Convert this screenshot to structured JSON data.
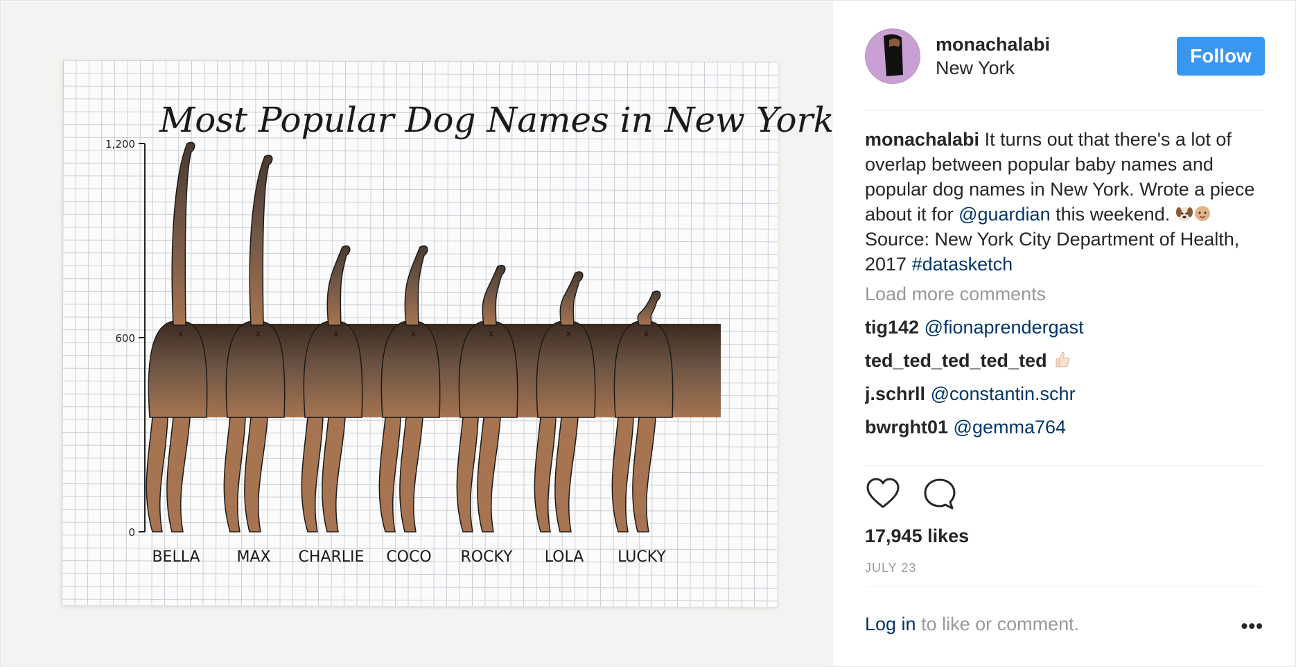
{
  "post": {
    "chart_image": {
      "chart_data": {
        "type": "bar",
        "title": "Most Popular Dog Names in New York",
        "categories": [
          "BELLA",
          "MAX",
          "CHARLIE",
          "COCO",
          "ROCKY",
          "LOLA",
          "LUCKY"
        ],
        "values": [
          1200,
          1160,
          880,
          880,
          820,
          800,
          740
        ],
        "ylim": [
          0,
          1200
        ],
        "y_ticks": [
          "1,200",
          "600",
          "0"
        ],
        "y_tick_values": [
          1200,
          600,
          0
        ],
        "xlabel": "",
        "ylabel": "",
        "grid": true,
        "bar_style": "dog-tail"
      },
      "colors": {
        "fur_dark": "#3a2a1e",
        "fur_mid": "#6b5344",
        "fur_light": "#a67450",
        "tail_tip": "#4b3a2f"
      }
    }
  },
  "header": {
    "username": "monachalabi",
    "location": "New York",
    "follow_label": "Follow"
  },
  "caption": {
    "username": "monachalabi",
    "text_part1": "It turns out that there's a lot of overlap between popular baby names and popular dog names in New York. Wrote a piece about it for",
    "mention": "@guardian",
    "text_part2": "this weekend.",
    "emoji_1": "dog-face-emoji",
    "emoji_2": "baby-emoji",
    "source_text": "Source: New York City Department of Health, 2017",
    "hashtag": "#datasketch"
  },
  "load_more_label": "Load more comments",
  "comments": [
    {
      "user": "tig142",
      "text": "@fionaprendergast",
      "is_mention": true
    },
    {
      "user": "ted_ted_ted_ted_ted",
      "text": "",
      "emoji": "thumbs-up-emoji"
    },
    {
      "user": "j.schrll",
      "text": "@constantin.schr",
      "is_mention": true
    },
    {
      "user": "bwrght01",
      "text": "@gemma764",
      "is_mention": true
    }
  ],
  "likes": "17,945 likes",
  "date": "JULY 23",
  "login": {
    "link_label": "Log in",
    "rest_label": "to like or comment.",
    "more_label": "•••"
  },
  "colors": {
    "follow_button": "#3897f0",
    "link": "#003569",
    "muted": "#999999",
    "text": "#262626"
  },
  "icons": [
    "heart-icon",
    "comment-icon",
    "more-options-icon"
  ]
}
